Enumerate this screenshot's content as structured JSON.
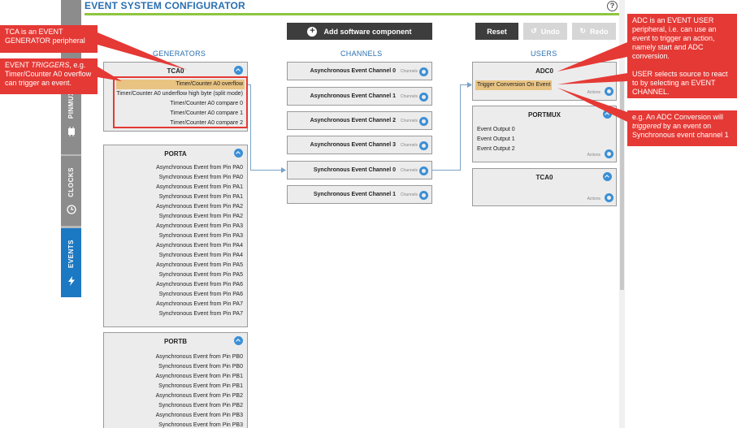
{
  "header": {
    "title": "EVENT SYSTEM CONFIGURATOR",
    "help": "?"
  },
  "nav": {
    "top": "",
    "pinmux": "PINMUX",
    "clocks": "CLOCKS",
    "events": "EVENTS",
    "pinmux_partial": "A",
    "top_partial": "D"
  },
  "toolbar": {
    "add": "Add software component",
    "reset": "Reset",
    "undo": "Undo",
    "redo": "Redo"
  },
  "columns": {
    "generators": "GENERATORS",
    "channels": "CHANNELS",
    "users": "USERS"
  },
  "generators": [
    {
      "title": "TCA0",
      "rows": [
        "Timer/Counter A0 overflow",
        "Timer/Counter A0 underflow high byte (split mode)",
        "Timer/Counter A0 compare 0",
        "Timer/Counter A0 compare 1",
        "Timer/Counter A0 compare 2"
      ]
    },
    {
      "title": "PORTA",
      "rows": [
        "Asynchronous Event from Pin PA0",
        "Synchronous Event from Pin PA0",
        "Asynchronous Event from Pin PA1",
        "Synchronous Event from Pin PA1",
        "Asynchronous Event from Pin PA2",
        "Synchronous Event from Pin PA2",
        "Asynchronous Event from Pin PA3",
        "Synchronous Event from Pin PA3",
        "Asynchronous Event from Pin PA4",
        "Synchronous Event from Pin PA4",
        "Asynchronous Event from Pin PA5",
        "Synchronous Event from Pin PA5",
        "Asynchronous Event from Pin PA6",
        "Synchronous Event from Pin PA6",
        "Asynchronous Event from Pin PA7",
        "Synchronous Event from Pin PA7"
      ]
    },
    {
      "title": "PORTB",
      "rows": [
        "Asynchronous Event from Pin PB0",
        "Synchronous Event from Pin PB0",
        "Asynchronous Event from Pin PB1",
        "Synchronous Event from Pin PB1",
        "Asynchronous Event from Pin PB2",
        "Synchronous Event from Pin PB2",
        "Asynchronous Event from Pin PB3",
        "Synchronous Event from Pin PB3"
      ]
    }
  ],
  "channels": [
    {
      "name": "Asynchronous Event Channel 0",
      "sub": "Channels"
    },
    {
      "name": "Asynchronous Event Channel 1",
      "sub": "Channels"
    },
    {
      "name": "Asynchronous Event Channel 2",
      "sub": "Channels"
    },
    {
      "name": "Asynchronous Event Channel 3",
      "sub": "Channels"
    },
    {
      "name": "Synchronous Event Channel 0",
      "sub": "Channels"
    },
    {
      "name": "Synchronous Event Channel 1",
      "sub": "Channels"
    }
  ],
  "users": [
    {
      "title": "ADC0",
      "rows": [
        "Trigger Conversion On Event"
      ],
      "actions": "Actions"
    },
    {
      "title": "PORTMUX",
      "rows": [
        "Event Output 0",
        "Event Output 1",
        "Event Output 2"
      ],
      "actions": "Actions"
    },
    {
      "title": "TCA0",
      "rows": [],
      "actions": "Actions"
    }
  ],
  "callouts": {
    "tca": "TCA is an EVENT GENERATOR peripheral",
    "triggers_prefix": "EVENT ",
    "triggers_italic": "TRIGGERS",
    "triggers_suffix": ", e.g. Timer/Counter A0 overflow can trigger an event.",
    "adc": "ADC is an EVENT USER peripheral, i.e. can use an event to trigger an action, namely start and ADC conversion.",
    "user": "USER selects source to react to by selecting an EVENT CHANNEL.",
    "eg_prefix": "e.g. An ADC Conversion will ",
    "eg_italic": "triggered",
    "eg_suffix": " by an event on Synchronous event channel 1"
  },
  "colors": {
    "accent_blue": "#2a6fb0",
    "green_line": "#8dc63f",
    "callout_red": "#e53935",
    "selected": "#e8c382",
    "events_tab": "#1b78c3"
  }
}
